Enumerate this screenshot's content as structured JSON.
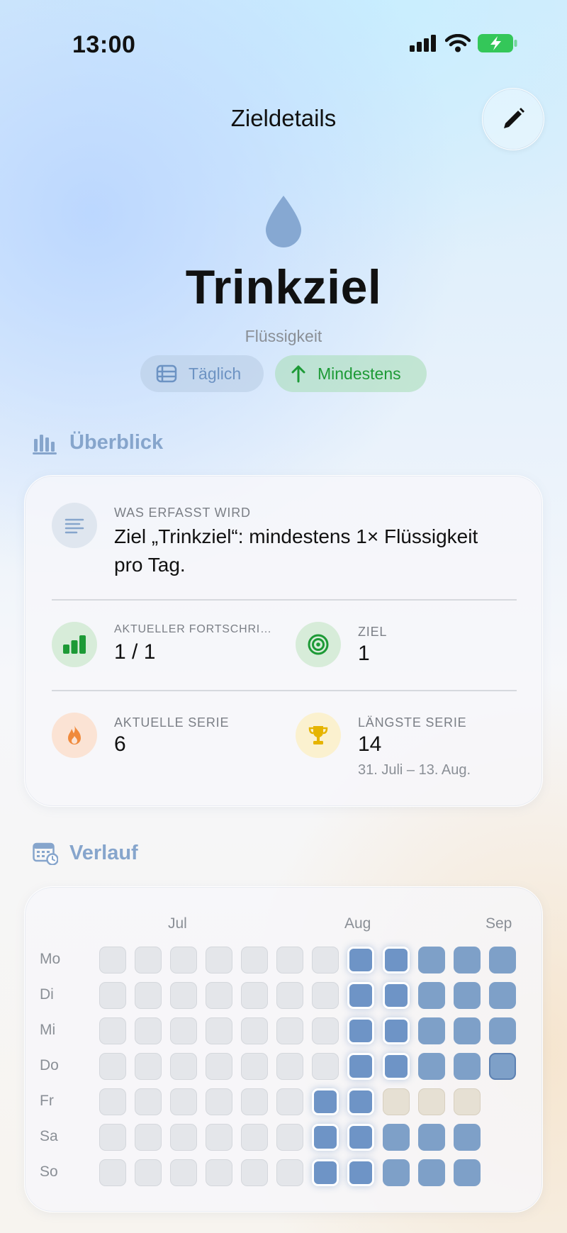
{
  "status_bar": {
    "time": "13:00"
  },
  "header": {
    "title": "Zieldetails"
  },
  "goal": {
    "name": "Trinkziel",
    "category": "Flüssigkeit",
    "frequency_label": "Täglich",
    "direction_label": "Mindestens"
  },
  "overview": {
    "section_title": "Überblick",
    "tracked_caption": "WAS ERFASST WIRD",
    "tracked_text": "Ziel „Trinkziel“: mindestens 1× Flüssigkeit pro Tag.",
    "progress_caption": "AKTUELLER FORTSCHRI…",
    "progress_value": "1 / 1",
    "goal_caption": "ZIEL",
    "goal_value": "1",
    "current_streak_caption": "AKTUELLE SERIE",
    "current_streak_value": "6",
    "longest_streak_caption": "LÄNGSTE SERIE",
    "longest_streak_value": "14",
    "longest_streak_range": "31. Juli – 13. Aug."
  },
  "history": {
    "section_title": "Verlauf",
    "months": [
      "Jul",
      "Aug",
      "Sep"
    ],
    "days": [
      "Mo",
      "Di",
      "Mi",
      "Do",
      "Fr",
      "Sa",
      "So"
    ],
    "legend_states": [
      "empty",
      "completed",
      "streak-highlight",
      "future",
      "today"
    ],
    "grid": [
      [
        "empty",
        "empty",
        "empty",
        "empty",
        "empty",
        "empty",
        "empty",
        "streak",
        "streak",
        "done",
        "done",
        "done"
      ],
      [
        "empty",
        "empty",
        "empty",
        "empty",
        "empty",
        "empty",
        "empty",
        "streak",
        "streak",
        "done",
        "done",
        "done"
      ],
      [
        "empty",
        "empty",
        "empty",
        "empty",
        "empty",
        "empty",
        "empty",
        "streak",
        "streak",
        "done",
        "done",
        "done"
      ],
      [
        "empty",
        "empty",
        "empty",
        "empty",
        "empty",
        "empty",
        "empty",
        "streak",
        "streak",
        "done",
        "done",
        "today"
      ],
      [
        "empty",
        "empty",
        "empty",
        "empty",
        "empty",
        "empty",
        "streak",
        "streak",
        "future",
        "future",
        "future",
        null
      ],
      [
        "empty",
        "empty",
        "empty",
        "empty",
        "empty",
        "empty",
        "streak",
        "streak",
        "done",
        "done",
        "done",
        null
      ],
      [
        "empty",
        "empty",
        "empty",
        "empty",
        "empty",
        "empty",
        "streak",
        "streak",
        "done",
        "done",
        "done",
        null
      ]
    ]
  },
  "colors": {
    "accent_blue": "#7ea0c8",
    "accent_green": "#1d9a36",
    "flame_orange": "#f08a3c",
    "trophy_yellow": "#e6b400",
    "battery_green": "#34c759"
  },
  "icons": {
    "edit": "pencil-icon",
    "goal": "water-drop-icon",
    "frequency": "calendar-rows-icon",
    "direction": "arrow-up-icon",
    "overview": "bar-chart-icon",
    "tracked": "text-lines-icon",
    "progress": "signal-bars-icon",
    "target": "target-icon",
    "current_streak": "flame-icon",
    "longest_streak": "trophy-icon",
    "history": "calendar-clock-icon"
  }
}
